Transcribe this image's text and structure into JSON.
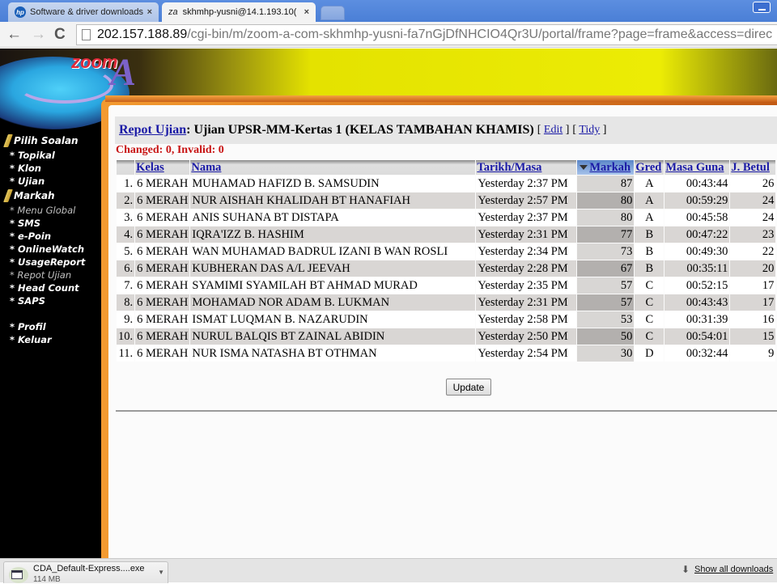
{
  "browser": {
    "tabs": [
      {
        "icon": "hp-icon",
        "icon_text": "hp",
        "label": "Software & driver downloads",
        "active": false
      },
      {
        "icon": "za-icon",
        "icon_text": "za",
        "label": "skhmhp-yusni@14.1.193.10(",
        "active": true
      }
    ],
    "close_glyph": "×",
    "url_host": "202.157.188.89",
    "url_path": "/cgi-bin/m/zoom-a-com-skhmhp-yusni-fa7nGjDfNHCIO4Qr3U/portal/frame?page=frame&access=direc",
    "back_glyph": "←",
    "forward_glyph": "→",
    "reload_glyph": "C"
  },
  "logo": {
    "text": "zoom",
    "letter": "A"
  },
  "sidebar": {
    "sections": [
      {
        "header": "Pilih Soalan",
        "items": [
          {
            "label": "* Topikal",
            "dim": false
          },
          {
            "label": "* Klon",
            "dim": false
          },
          {
            "label": "* Ujian",
            "dim": false
          }
        ]
      },
      {
        "header": "Markah",
        "items": [
          {
            "label": "* Menu Global",
            "dim": true
          },
          {
            "label": "* SMS",
            "dim": false
          },
          {
            "label": "* e-Poin",
            "dim": false
          },
          {
            "label": "* OnlineWatch",
            "dim": false
          },
          {
            "label": "* UsageReport",
            "dim": false
          },
          {
            "label": "* Repot Ujian",
            "dim": true
          },
          {
            "label": "* Head Count",
            "dim": false
          },
          {
            "label": "* SAPS",
            "dim": false
          }
        ]
      }
    ],
    "footer_items": [
      "* Profil",
      "* Keluar"
    ]
  },
  "report": {
    "breadcrumb_link": "Repot Ujian",
    "title": ": Ujian UPSR-MM-Kertas 1 (KELAS TAMBAHAN KHAMIS)",
    "edit_label": "Edit",
    "tidy_label": "Tidy",
    "status": "Changed: 0, Invalid: 0",
    "columns": [
      "",
      "Kelas",
      "Nama",
      "Tarikh/Masa",
      "Markah",
      "Gred",
      "Masa Guna",
      "J. Betul"
    ],
    "sorted_column": "Markah",
    "rows": [
      {
        "no": "1.",
        "kelas": "6 MERAH",
        "nama": "MUHAMAD HAFIZD B. SAMSUDIN",
        "tarikh": "Yesterday 2:37 PM",
        "markah": "87",
        "gred": "A",
        "masa": "00:43:44",
        "betul": "26"
      },
      {
        "no": "2.",
        "kelas": "6 MERAH",
        "nama": "NUR AISHAH KHALIDAH BT HANAFIAH",
        "tarikh": "Yesterday 2:57 PM",
        "markah": "80",
        "gred": "A",
        "masa": "00:59:29",
        "betul": "24"
      },
      {
        "no": "3.",
        "kelas": "6 MERAH",
        "nama": "ANIS SUHANA BT DISTAPA",
        "tarikh": "Yesterday 2:37 PM",
        "markah": "80",
        "gred": "A",
        "masa": "00:45:58",
        "betul": "24"
      },
      {
        "no": "4.",
        "kelas": "6 MERAH",
        "nama": "IQRA'IZZ B. HASHIM",
        "tarikh": "Yesterday 2:31 PM",
        "markah": "77",
        "gred": "B",
        "masa": "00:47:22",
        "betul": "23"
      },
      {
        "no": "5.",
        "kelas": "6 MERAH",
        "nama": "WAN MUHAMAD BADRUL IZANI B WAN ROSLI",
        "tarikh": "Yesterday 2:34 PM",
        "markah": "73",
        "gred": "B",
        "masa": "00:49:30",
        "betul": "22"
      },
      {
        "no": "6.",
        "kelas": "6 MERAH",
        "nama": "KUBHERAN DAS A/L JEEVAH",
        "tarikh": "Yesterday 2:28 PM",
        "markah": "67",
        "gred": "B",
        "masa": "00:35:11",
        "betul": "20"
      },
      {
        "no": "7.",
        "kelas": "6 MERAH",
        "nama": "SYAMIMI SYAMILAH BT AHMAD MURAD",
        "tarikh": "Yesterday 2:35 PM",
        "markah": "57",
        "gred": "C",
        "masa": "00:52:15",
        "betul": "17"
      },
      {
        "no": "8.",
        "kelas": "6 MERAH",
        "nama": "MOHAMAD NOR ADAM B. LUKMAN",
        "tarikh": "Yesterday 2:31 PM",
        "markah": "57",
        "gred": "C",
        "masa": "00:43:43",
        "betul": "17"
      },
      {
        "no": "9.",
        "kelas": "6 MERAH",
        "nama": "ISMAT LUQMAN B. NAZARUDIN",
        "tarikh": "Yesterday 2:58 PM",
        "markah": "53",
        "gred": "C",
        "masa": "00:31:39",
        "betul": "16"
      },
      {
        "no": "10.",
        "kelas": "6 MERAH",
        "nama": "NURUL BALQIS BT ZAINAL ABIDIN",
        "tarikh": "Yesterday 2:50 PM",
        "markah": "50",
        "gred": "C",
        "masa": "00:54:01",
        "betul": "15"
      },
      {
        "no": "11.",
        "kelas": "6 MERAH",
        "nama": "NUR ISMA NATASHA BT OTHMAN",
        "tarikh": "Yesterday 2:54 PM",
        "markah": "30",
        "gred": "D",
        "masa": "00:32:44",
        "betul": "9"
      }
    ],
    "update_label": "Update"
  },
  "downloads": {
    "item_name": "CDA_Default-Express....exe",
    "item_size": "114 MB",
    "show_all_label": "Show all downloads"
  },
  "colors": {
    "link": "#1a1aa6",
    "status_red": "#c81414",
    "frame_orange": "#f39a30",
    "banner_yellow": "#ecec05"
  }
}
